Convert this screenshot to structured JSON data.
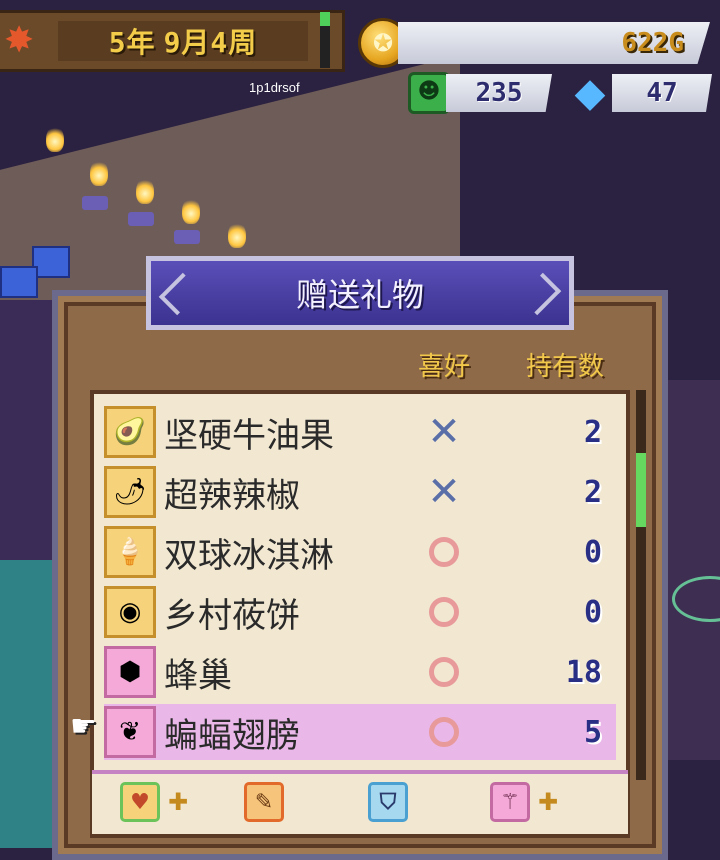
{
  "hud": {
    "date": {
      "year": "5年",
      "month_day": "9月4周"
    },
    "gold": "622G",
    "mana": "235",
    "crystal": "47",
    "username": "1p1drsof",
    "time_gauge_fraction": 0.25
  },
  "dialog": {
    "title": "赠送礼物",
    "col_preference": "喜好",
    "col_count": "持有数",
    "items": [
      {
        "name": "坚硬牛油果",
        "preference": "x",
        "count": "2",
        "icon": "avocado-icon",
        "frame": "gold"
      },
      {
        "name": "超辣辣椒",
        "preference": "x",
        "count": "2",
        "icon": "chili-icon",
        "frame": "gold"
      },
      {
        "name": "双球冰淇淋",
        "preference": "o",
        "count": "0",
        "icon": "ice-cream-icon",
        "frame": "gold"
      },
      {
        "name": "乡村莜饼",
        "preference": "o",
        "count": "0",
        "icon": "pancake-icon",
        "frame": "gold"
      },
      {
        "name": "蜂巢",
        "preference": "o",
        "count": "18",
        "icon": "honeycomb-icon",
        "frame": "pink"
      },
      {
        "name": "蝙蝠翅膀",
        "preference": "o",
        "count": "5",
        "icon": "bat-wing-icon",
        "frame": "pink",
        "selected": true
      }
    ],
    "scroll_fraction": 0.2
  },
  "filters": [
    {
      "icon": "heart-icon",
      "plus": true
    },
    {
      "icon": "scroll-icon",
      "plus": false
    },
    {
      "icon": "shield-icon",
      "plus": false
    },
    {
      "icon": "wand-icon",
      "plus": true
    }
  ],
  "colors": {
    "title_banner": "#3b3290",
    "selected_row": "#e9b7e8",
    "header_gold": "#f2c84a",
    "count_blue": "#2a2f86"
  }
}
